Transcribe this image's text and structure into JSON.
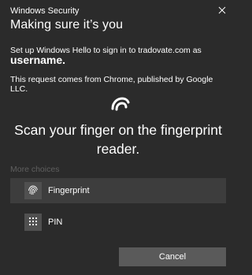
{
  "window": {
    "title": "Windows Security"
  },
  "header": {
    "heading": "Making sure it’s you"
  },
  "message": {
    "line1": "Set up Windows Hello to sign in to tradovate.com as",
    "username": "username.",
    "request": "This request comes from Chrome, published by Google LLC."
  },
  "prompt": {
    "scan_text": "Scan your finger on the fingerprint reader."
  },
  "choices": {
    "header": "More choices",
    "items": [
      {
        "label": "Fingerprint",
        "icon": "fingerprint-icon",
        "selected": true
      },
      {
        "label": "PIN",
        "icon": "pin-keypad-icon",
        "selected": false
      }
    ]
  },
  "actions": {
    "cancel_label": "Cancel"
  }
}
